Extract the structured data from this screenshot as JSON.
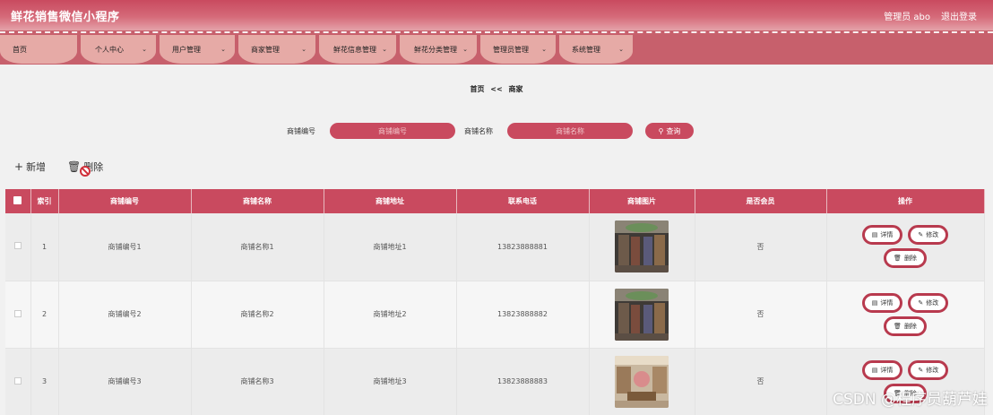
{
  "header": {
    "title": "鲜花销售微信小程序",
    "user": "管理员 abo",
    "logout": "退出登录"
  },
  "nav": [
    {
      "label": "首页",
      "has_menu": false
    },
    {
      "label": "个人中心",
      "has_menu": true
    },
    {
      "label": "用户管理",
      "has_menu": true
    },
    {
      "label": "商家管理",
      "has_menu": true
    },
    {
      "label": "鲜花信息管理",
      "has_menu": true
    },
    {
      "label": "鲜花分类管理",
      "has_menu": true
    },
    {
      "label": "管理员管理",
      "has_menu": true
    },
    {
      "label": "系统管理",
      "has_menu": true
    }
  ],
  "breadcrumb": {
    "home": "首页",
    "sep": "<<",
    "current": "商家"
  },
  "search": {
    "code_label": "商铺编号",
    "code_placeholder": "商铺编号",
    "name_label": "商铺名称",
    "name_placeholder": "商铺名称",
    "button": "查询",
    "button_icon": "search-icon"
  },
  "toolbar": {
    "add": "新增",
    "delete": "删除"
  },
  "table": {
    "columns": [
      "索引",
      "商铺编号",
      "商铺名称",
      "商铺地址",
      "联系电话",
      "商铺图片",
      "是否会员",
      "操作"
    ],
    "rows": [
      {
        "index": "1",
        "code": "商铺编号1",
        "name": "商铺名称1",
        "address": "商铺地址1",
        "phone": "13823888881",
        "member": "否"
      },
      {
        "index": "2",
        "code": "商铺编号2",
        "name": "商铺名称2",
        "address": "商铺地址2",
        "phone": "13823888882",
        "member": "否"
      },
      {
        "index": "3",
        "code": "商铺编号3",
        "name": "商铺名称3",
        "address": "商铺地址3",
        "phone": "13823888883",
        "member": "否"
      }
    ],
    "actions": {
      "detail": "详情",
      "edit": "修改",
      "delete": "删除"
    }
  },
  "watermark": "CSDN @程序员葫芦娃",
  "colors": {
    "primary": "#c94a5f",
    "nav_tab": "#e6aaa6",
    "background": "#f1f1f1"
  }
}
